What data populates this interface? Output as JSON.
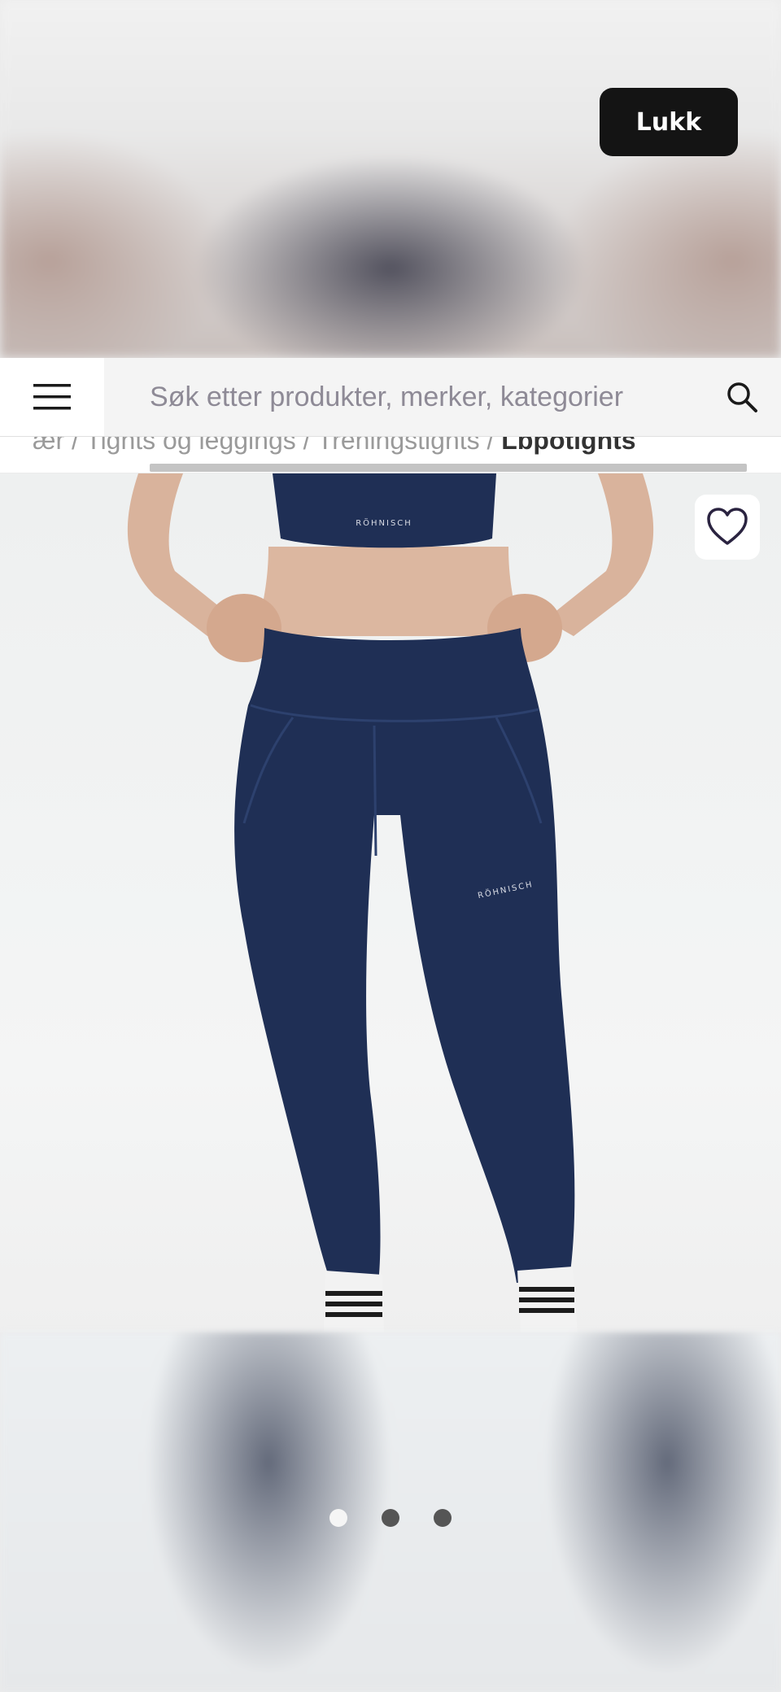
{
  "overlay": {
    "close_label": "Lukk"
  },
  "header": {
    "menu_icon": "hamburger-menu-icon",
    "search_placeholder": "Søk etter produkter, merker, kategorier",
    "search_icon": "search-icon"
  },
  "breadcrumb": {
    "items": [
      "ær",
      "Tights og leggings",
      "Treningstights"
    ],
    "separator": "/",
    "current": "Lbpotights"
  },
  "product": {
    "image_description_icon": "product-image",
    "favorite_icon": "heart-icon",
    "top_brand_print": "RÖHNISCH",
    "leg_brand_print": "RÖHNISCH"
  },
  "carousel": {
    "dot_count": 3,
    "active_index": 0
  },
  "colors": {
    "accent_dark": "#141414",
    "leggings_navy": "#1f2f55",
    "favorite_stroke": "#2a2340"
  }
}
